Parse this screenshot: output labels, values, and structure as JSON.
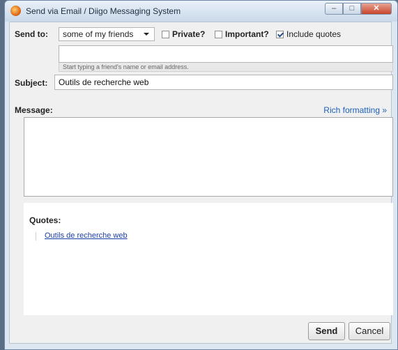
{
  "window": {
    "title": "Send via Email / Diigo Messaging System",
    "controls": {
      "minimize": "–",
      "maximize": "□",
      "close": "✕"
    }
  },
  "send_to": {
    "label": "Send to:",
    "selected": "some of my friends"
  },
  "checkboxes": [
    {
      "label": "Private?",
      "checked": false,
      "bold": true
    },
    {
      "label": "Important?",
      "checked": false,
      "bold": true
    },
    {
      "label": "Include quotes",
      "checked": true,
      "bold": false
    }
  ],
  "recipients": {
    "value": "",
    "hint": "Start typing a friend's name or email address."
  },
  "subject": {
    "label": "Subject:",
    "value": "Outils de recherche web"
  },
  "message": {
    "label": "Message:",
    "rich_formatting": "Rich formatting »",
    "value": ""
  },
  "quotes": {
    "title": "Quotes:",
    "items": [
      "Outils de recherche web"
    ]
  },
  "buttons": {
    "send": "Send",
    "cancel": "Cancel"
  },
  "colors": {
    "link": "#1f5fb5",
    "window_frame": "#dde7f1",
    "close_button": "#c8442b"
  },
  "icons": {
    "app": "firefox-icon"
  }
}
